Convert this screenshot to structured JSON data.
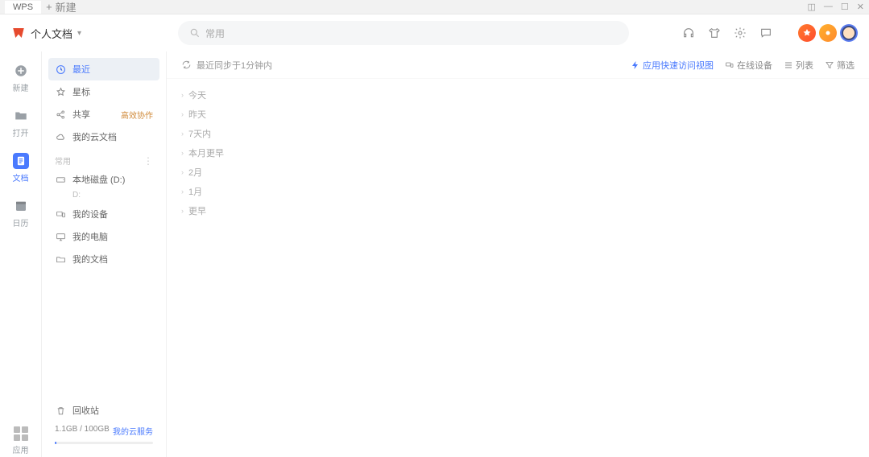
{
  "titlebar": {
    "app": "WPS",
    "new_tab": "新建"
  },
  "header": {
    "title": "个人文档",
    "search_placeholder": "常用"
  },
  "rail": {
    "new": "新建",
    "open": "打开",
    "docs": "文档",
    "calendar": "日历",
    "apps": "应用"
  },
  "sidebar": {
    "recent": "最近",
    "star": "星标",
    "share": "共享",
    "share_badge": "高效协作",
    "cloud": "我的云文档",
    "section": "常用",
    "local_disk": "本地磁盘 (D:)",
    "local_disk_sub": "D:",
    "my_devices": "我的设备",
    "my_computer": "我的电脑",
    "my_docs": "我的文档",
    "recycle": "回收站",
    "storage_used": "1.1GB / 100GB",
    "cloud_service": "我的云服务"
  },
  "toolbar": {
    "sync": "最近同步于1分钟内",
    "quick_access": "应用快速访问视图",
    "online_devices": "在线设备",
    "list": "列表",
    "filter": "筛选"
  },
  "groups": [
    "今天",
    "昨天",
    "7天内",
    "本月更早",
    "2月",
    "1月",
    "更早"
  ]
}
